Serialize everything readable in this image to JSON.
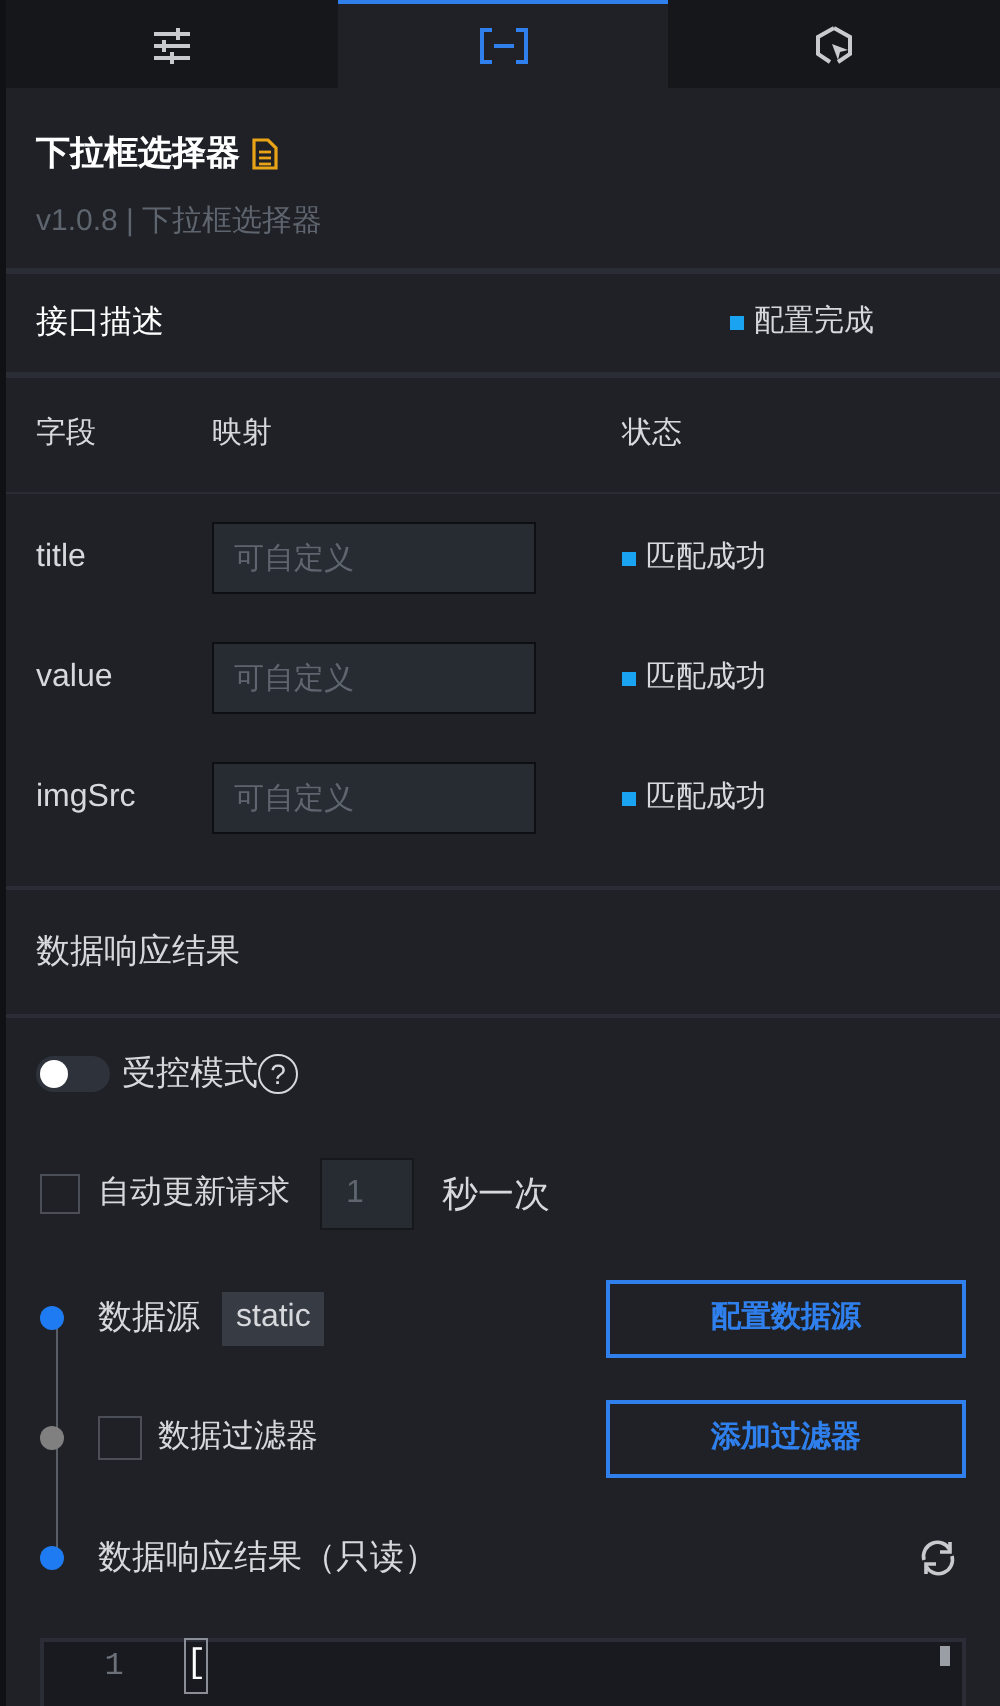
{
  "tabs": [
    {
      "kind": "sliders",
      "selected": false
    },
    {
      "kind": "brackets",
      "selected": true
    },
    {
      "kind": "cursor",
      "selected": false
    }
  ],
  "component": {
    "title": "下拉框选择器",
    "subtitle": "v1.0.8 | 下拉框选择器"
  },
  "interface": {
    "title": "接口描述",
    "status": "配置完成"
  },
  "field_table": {
    "columns": [
      "字段",
      "映射",
      "状态"
    ],
    "rows": [
      {
        "field": "title",
        "placeholder": "可自定义",
        "status": "匹配成功"
      },
      {
        "field": "value",
        "placeholder": "可自定义",
        "status": "匹配成功"
      },
      {
        "field": "imgSrc",
        "placeholder": "可自定义",
        "status": "匹配成功"
      }
    ]
  },
  "response_section": {
    "title": "数据响应结果"
  },
  "controlled_mode": {
    "label": "受控模式",
    "on": false,
    "help": "?"
  },
  "auto_update": {
    "label": "自动更新请求",
    "checked": false,
    "value": "1",
    "unit": "秒一次"
  },
  "steps": [
    {
      "kind": "source",
      "label": "数据源",
      "tag": "static",
      "button": "配置数据源",
      "color": "#1f7bf2"
    },
    {
      "kind": "filter",
      "label": "数据过滤器",
      "checked": false,
      "button": "添加过滤器",
      "color": "#808080"
    },
    {
      "kind": "result",
      "label": "数据响应结果（只读）",
      "color": "#1f7bf2"
    }
  ],
  "code_editor": {
    "lines": [
      {
        "number": "1",
        "text": "["
      }
    ]
  }
}
